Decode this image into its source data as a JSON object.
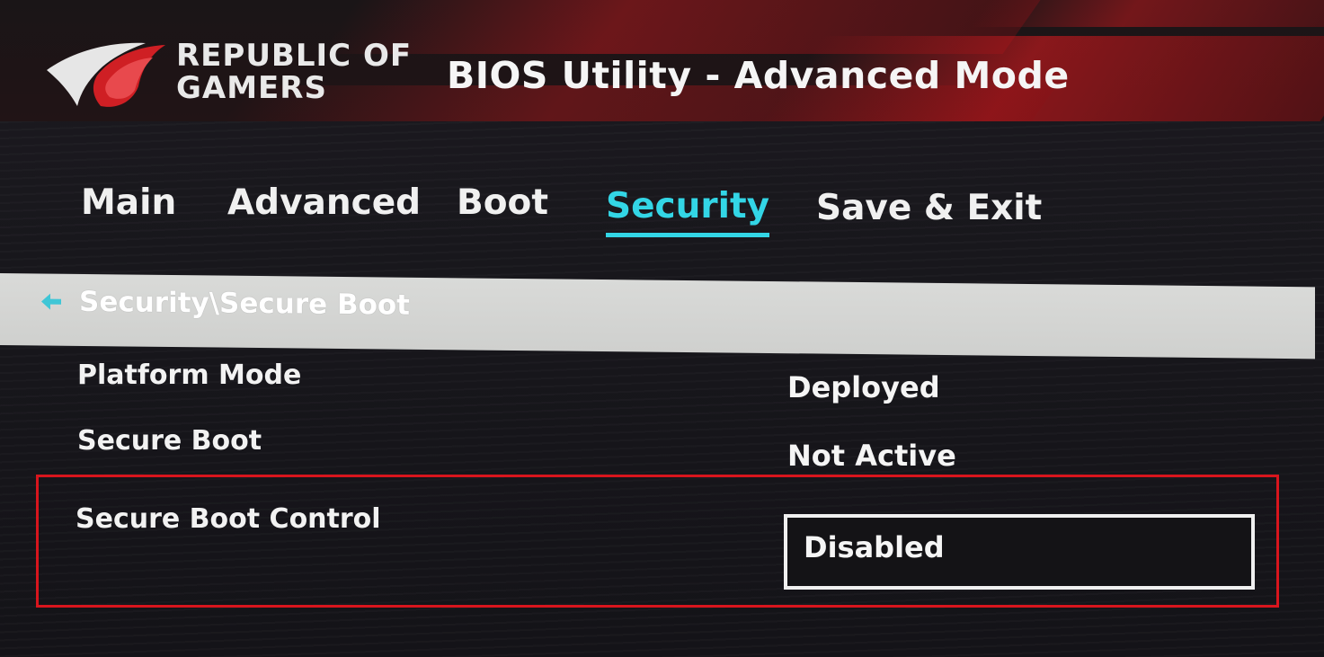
{
  "header": {
    "brand_line1": "REPUBLIC OF",
    "brand_line2": "GAMERS",
    "title": "BIOS Utility - Advanced Mode"
  },
  "tabs": [
    {
      "label": "Main",
      "active": false
    },
    {
      "label": "Advanced",
      "active": false
    },
    {
      "label": "Boot",
      "active": false
    },
    {
      "label": "Security",
      "active": true
    },
    {
      "label": "Save & Exit",
      "active": false
    }
  ],
  "breadcrumb": {
    "back_icon": "arrow-left-icon",
    "path": "Security\\Secure Boot"
  },
  "settings": [
    {
      "label": "Platform Mode",
      "value": "Deployed"
    },
    {
      "label": "Secure Boot",
      "value": "Not Active"
    },
    {
      "label": "Secure Boot Control",
      "value": "Disabled"
    }
  ],
  "colors": {
    "accent": "#33d6e6",
    "highlight": "#d8151d",
    "brand_red": "#c8191e"
  }
}
